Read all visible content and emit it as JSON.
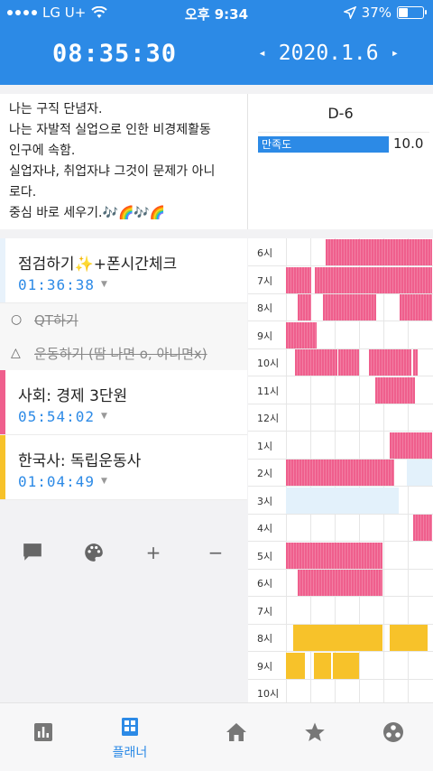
{
  "status": {
    "carrier": "LG U+",
    "time": "오후 9:34",
    "battery": "37%",
    "battery_level": 0.37
  },
  "header": {
    "timer": "08:35:30",
    "date": "2020.1.6",
    "prev_arrow": "◂",
    "next_arrow": "▸"
  },
  "memo": "나는 구직 단념자.\n나는 자발적 실업으로 인한 비경제활동\n인구에 속함.\n실업자냐, 취업자냐 그것이 문제가 아니\n로다.\n중심 바로 세우기.🎶🌈🎶🌈",
  "dday": "D-6",
  "satisfaction": {
    "label": "만족도",
    "value": "10.0"
  },
  "tasks": [
    {
      "kind": "timer",
      "name": "점검하기✨+폰시간체크",
      "time": "01:36:38",
      "color": "#e8f2fb"
    },
    {
      "kind": "plain",
      "marker": "○",
      "name": "QT하기"
    },
    {
      "kind": "plain",
      "marker": "△",
      "name": "운동하기 (땀 나면 o, 아니면x)"
    },
    {
      "kind": "timer",
      "name": "사회: 경제 3단원",
      "time": "05:54:02",
      "color": "#ef5f8d"
    },
    {
      "kind": "timer",
      "name": "한국사: 독립운동사",
      "time": "01:04:49",
      "color": "#f7c22a"
    }
  ],
  "actions": [
    "comment-icon",
    "palette-icon",
    "+",
    "−"
  ],
  "timetable": {
    "hours": [
      "6시",
      "7시",
      "8시",
      "9시",
      "10시",
      "11시",
      "12시",
      "1시",
      "2시",
      "3시",
      "4시",
      "5시",
      "6시",
      "7시",
      "8시",
      "9시",
      "10시"
    ],
    "colors": {
      "pink": "#ef5f8d",
      "yellow": "#f7c22a",
      "light": "#e3f1fb"
    },
    "rows": [
      [
        [
          "pink",
          0.27,
          1.0
        ]
      ],
      [
        [
          "pink",
          0.0,
          0.17
        ],
        [
          "pink",
          0.2,
          1.0
        ]
      ],
      [
        [
          "pink",
          0.08,
          0.17
        ],
        [
          "pink",
          0.25,
          0.62
        ],
        [
          "pink",
          0.78,
          1.0
        ]
      ],
      [
        [
          "pink",
          0.0,
          0.21
        ]
      ],
      [
        [
          "pink",
          0.06,
          0.35
        ],
        [
          "pink",
          0.36,
          0.5
        ],
        [
          "pink",
          0.57,
          0.86
        ],
        [
          "pink",
          0.87,
          0.9
        ]
      ],
      [
        [
          "pink",
          0.61,
          0.88
        ]
      ],
      [],
      [
        [
          "pink",
          0.71,
          1.0
        ]
      ],
      [
        [
          "pink",
          0.0,
          0.74
        ],
        [
          "light",
          0.83,
          1.0
        ]
      ],
      [
        [
          "light",
          0.0,
          0.77
        ]
      ],
      [
        [
          "pink",
          0.87,
          1.0
        ]
      ],
      [
        [
          "pink",
          0.0,
          0.66
        ]
      ],
      [
        [
          "pink",
          0.08,
          0.66
        ]
      ],
      [],
      [
        [
          "yellow",
          0.05,
          0.66
        ],
        [
          "yellow",
          0.71,
          0.97
        ]
      ],
      [
        [
          "yellow",
          0.0,
          0.13
        ],
        [
          "yellow",
          0.19,
          0.31
        ],
        [
          "yellow",
          0.32,
          0.5
        ]
      ],
      []
    ]
  },
  "tabbar": {
    "active_label": "플래너",
    "tabs": [
      "chart-icon",
      "planner-icon",
      "home-icon",
      "star-icon",
      "social-icon"
    ]
  }
}
